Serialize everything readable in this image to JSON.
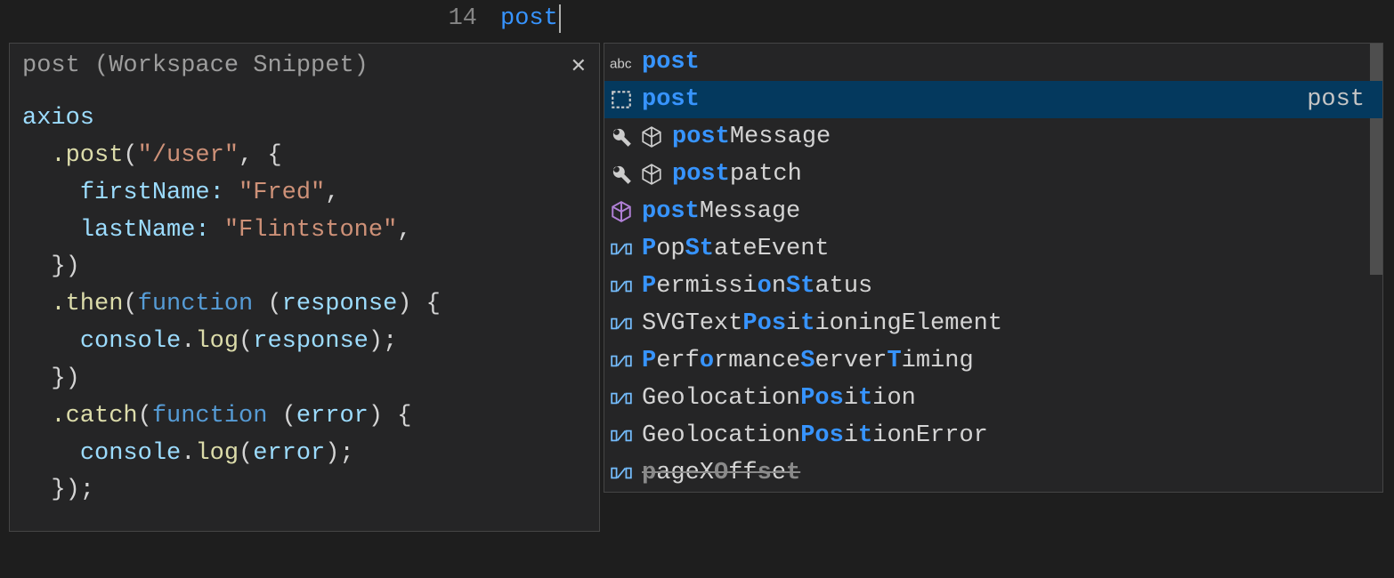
{
  "editor": {
    "line_number": "14",
    "typed_text": "post"
  },
  "details": {
    "title": "post (Workspace Snippet)",
    "snippet": {
      "l1": {
        "axios": "axios"
      },
      "l2": {
        "post": ".post",
        "openParen": "(",
        "url": "\"/user\"",
        "comma": ", {"
      },
      "l3": {
        "key": "firstName:",
        "val": " \"Fred\"",
        "comma": ","
      },
      "l4": {
        "key": "lastName:",
        "val": " \"Flintstone\"",
        "comma": ","
      },
      "l5": {
        "close": "})"
      },
      "l6": {
        "then": ".then",
        "open": "(",
        "fn": "function ",
        "paren": "(",
        "param": "response",
        "close": ") {"
      },
      "l7": {
        "console": "console",
        "dot": ".",
        "log": "log",
        "open": "(",
        "param": "response",
        "close": ");"
      },
      "l8": {
        "close": "})"
      },
      "l9": {
        "catch": ".catch",
        "open": "(",
        "fn": "function ",
        "paren": "(",
        "param": "error",
        "close": ") {"
      },
      "l10": {
        "console": "console",
        "dot": ".",
        "log": "log",
        "open": "(",
        "param": "error",
        "close": ");"
      },
      "l11": {
        "close": "});"
      }
    }
  },
  "suggestions": [
    {
      "icons": [
        "abc"
      ],
      "segments": [
        [
          "post",
          true
        ]
      ],
      "detail": "",
      "selected": false,
      "deprecated": false
    },
    {
      "icons": [
        "snippet"
      ],
      "segments": [
        [
          "post",
          true
        ]
      ],
      "detail": "post",
      "selected": true,
      "deprecated": false
    },
    {
      "icons": [
        "wrench",
        "cube-outline"
      ],
      "segments": [
        [
          "post",
          true
        ],
        [
          "Message",
          false
        ]
      ],
      "detail": "",
      "selected": false,
      "deprecated": false
    },
    {
      "icons": [
        "wrench",
        "cube-outline"
      ],
      "segments": [
        [
          "post",
          true
        ],
        [
          "patch",
          false
        ]
      ],
      "detail": "",
      "selected": false,
      "deprecated": false
    },
    {
      "icons": [
        "cube"
      ],
      "segments": [
        [
          "post",
          true
        ],
        [
          "Message",
          false
        ]
      ],
      "detail": "",
      "selected": false,
      "deprecated": false
    },
    {
      "icons": [
        "variable"
      ],
      "segments": [
        [
          "P",
          true
        ],
        [
          "op",
          false
        ],
        [
          "St",
          true
        ],
        [
          "ateEvent",
          false
        ]
      ],
      "detail": "",
      "selected": false,
      "deprecated": false
    },
    {
      "icons": [
        "variable"
      ],
      "segments": [
        [
          "P",
          true
        ],
        [
          "ermissi",
          false
        ],
        [
          "o",
          true
        ],
        [
          "n",
          false
        ],
        [
          "St",
          true
        ],
        [
          "atus",
          false
        ]
      ],
      "detail": "",
      "selected": false,
      "deprecated": false
    },
    {
      "icons": [
        "variable"
      ],
      "segments": [
        [
          "SVGText",
          false
        ],
        [
          "Pos",
          true
        ],
        [
          "i",
          false
        ],
        [
          "t",
          true
        ],
        [
          "ioningElement",
          false
        ]
      ],
      "detail": "",
      "selected": false,
      "deprecated": false
    },
    {
      "icons": [
        "variable"
      ],
      "segments": [
        [
          "P",
          true
        ],
        [
          "erf",
          false
        ],
        [
          "o",
          true
        ],
        [
          "rmance",
          false
        ],
        [
          "S",
          true
        ],
        [
          "erver",
          false
        ],
        [
          "T",
          true
        ],
        [
          "iming",
          false
        ]
      ],
      "detail": "",
      "selected": false,
      "deprecated": false
    },
    {
      "icons": [
        "variable"
      ],
      "segments": [
        [
          "Geolocation",
          false
        ],
        [
          "Pos",
          true
        ],
        [
          "i",
          false
        ],
        [
          "t",
          true
        ],
        [
          "ion",
          false
        ]
      ],
      "detail": "",
      "selected": false,
      "deprecated": false
    },
    {
      "icons": [
        "variable"
      ],
      "segments": [
        [
          "Geolocation",
          false
        ],
        [
          "Pos",
          true
        ],
        [
          "i",
          false
        ],
        [
          "t",
          true
        ],
        [
          "ionError",
          false
        ]
      ],
      "detail": "",
      "selected": false,
      "deprecated": false
    },
    {
      "icons": [
        "variable"
      ],
      "segments": [
        [
          "p",
          true
        ],
        [
          "ageX",
          false
        ],
        [
          "O",
          true
        ],
        [
          "ff",
          false
        ],
        [
          "s",
          true
        ],
        [
          "e",
          false
        ],
        [
          "t",
          true
        ]
      ],
      "detail": "",
      "selected": false,
      "deprecated": true
    }
  ]
}
